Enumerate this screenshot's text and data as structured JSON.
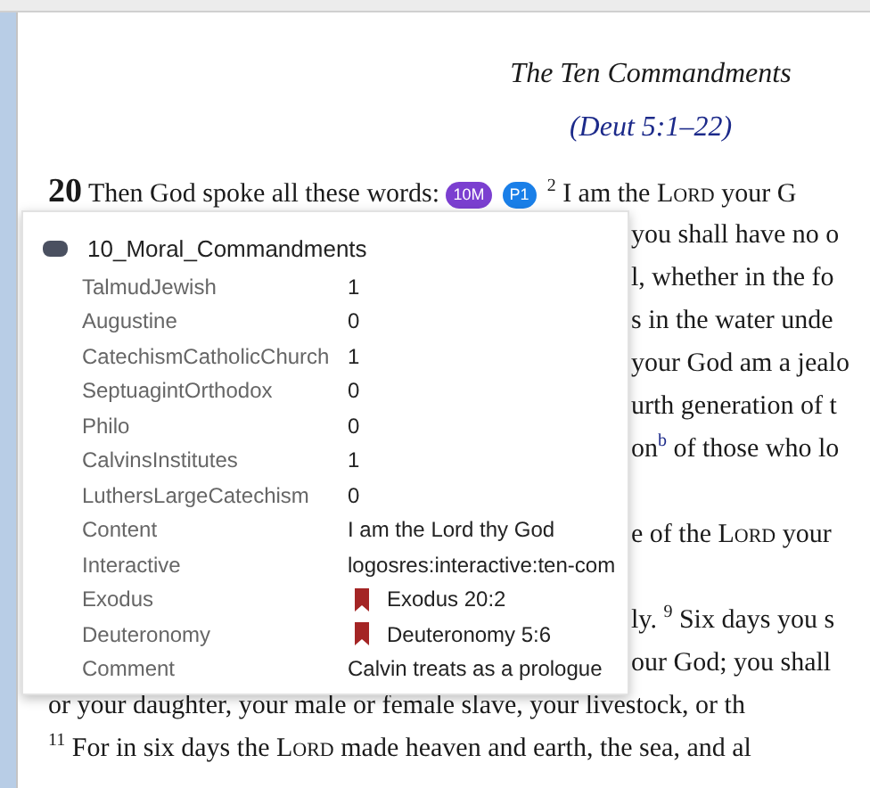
{
  "heading": {
    "title": "The Ten Commandments",
    "reference": "(Deut 5:1–22)"
  },
  "lines": [
    {
      "kind": "verse-start",
      "segments": [
        {
          "kind": "chapter",
          "text": "20"
        },
        {
          "kind": "plain",
          "text": " Then God spoke all these words: "
        },
        {
          "kind": "badge",
          "text": "10M",
          "color": "#7b3fd0"
        },
        {
          "kind": "badge",
          "text": "P1",
          "color": "#1a7fe8"
        },
        {
          "kind": "sup",
          "text": "2"
        },
        {
          "kind": "plain",
          "text": " I am the "
        },
        {
          "kind": "smallcaps",
          "text": "Lord"
        },
        {
          "kind": "plain",
          "text": " your G"
        }
      ]
    },
    {
      "kind": "behind",
      "segments": [
        {
          "kind": "plain",
          "text": "you shall have no o"
        }
      ]
    },
    {
      "kind": "behind",
      "segments": [
        {
          "kind": "plain",
          "text": "l, whether in the fo"
        }
      ]
    },
    {
      "kind": "behind",
      "segments": [
        {
          "kind": "plain",
          "text": "s in the water unde"
        }
      ]
    },
    {
      "kind": "behind",
      "segments": [
        {
          "kind": "plain",
          "text": "your God am a jealo"
        }
      ]
    },
    {
      "kind": "behind",
      "segments": [
        {
          "kind": "plain",
          "text": "urth generation of t"
        }
      ]
    },
    {
      "kind": "behind",
      "segments": [
        {
          "kind": "plain",
          "text": "on"
        },
        {
          "kind": "note",
          "text": "b"
        },
        {
          "kind": "plain",
          "text": " of those who lo"
        }
      ]
    },
    {
      "kind": "blank"
    },
    {
      "kind": "behind",
      "segments": [
        {
          "kind": "plain",
          "text": "e of the "
        },
        {
          "kind": "smallcaps",
          "text": "Lord"
        },
        {
          "kind": "plain",
          "text": " your"
        }
      ]
    },
    {
      "kind": "blank"
    },
    {
      "kind": "behind",
      "segments": [
        {
          "kind": "plain",
          "text": "ly. "
        },
        {
          "kind": "sup",
          "text": "9"
        },
        {
          "kind": "plain",
          "text": " Six days you s"
        }
      ]
    },
    {
      "kind": "behind",
      "segments": [
        {
          "kind": "plain",
          "text": "our God; you shall"
        }
      ]
    },
    {
      "kind": "full",
      "segments": [
        {
          "kind": "plain",
          "text": "or your daughter, your male or female slave, your livestock, or th"
        }
      ]
    },
    {
      "kind": "full",
      "segments": [
        {
          "kind": "sup",
          "text": "11"
        },
        {
          "kind": "plain",
          "text": " For in six days the "
        },
        {
          "kind": "smallcaps",
          "text": "Lord"
        },
        {
          "kind": "plain",
          "text": " made heaven and earth, the sea, and al"
        }
      ]
    }
  ],
  "popup": {
    "title": "10_Moral_Commandments",
    "rows": [
      {
        "label": "TalmudJewish",
        "value": "1",
        "kind": "text"
      },
      {
        "label": "Augustine",
        "value": "0",
        "kind": "text"
      },
      {
        "label": "CatechismCatholicChurch",
        "value": "1",
        "kind": "text"
      },
      {
        "label": "SeptuagintOrthodox",
        "value": "0",
        "kind": "text"
      },
      {
        "label": "Philo",
        "value": "0",
        "kind": "text"
      },
      {
        "label": "CalvinsInstitutes",
        "value": "1",
        "kind": "text"
      },
      {
        "label": "LuthersLargeCatechism",
        "value": "0",
        "kind": "text"
      },
      {
        "label": "Content",
        "value": "I am the Lord thy God",
        "kind": "text"
      },
      {
        "label": "Interactive",
        "value": "logosres:interactive:ten-com",
        "kind": "text"
      },
      {
        "label": "Exodus",
        "value": "Exodus 20:2",
        "kind": "reference"
      },
      {
        "label": "Deuteronomy",
        "value": "Deuteronomy 5:6",
        "kind": "reference"
      },
      {
        "label": "Comment",
        "value": "Calvin treats as a prologue",
        "kind": "text"
      }
    ]
  }
}
